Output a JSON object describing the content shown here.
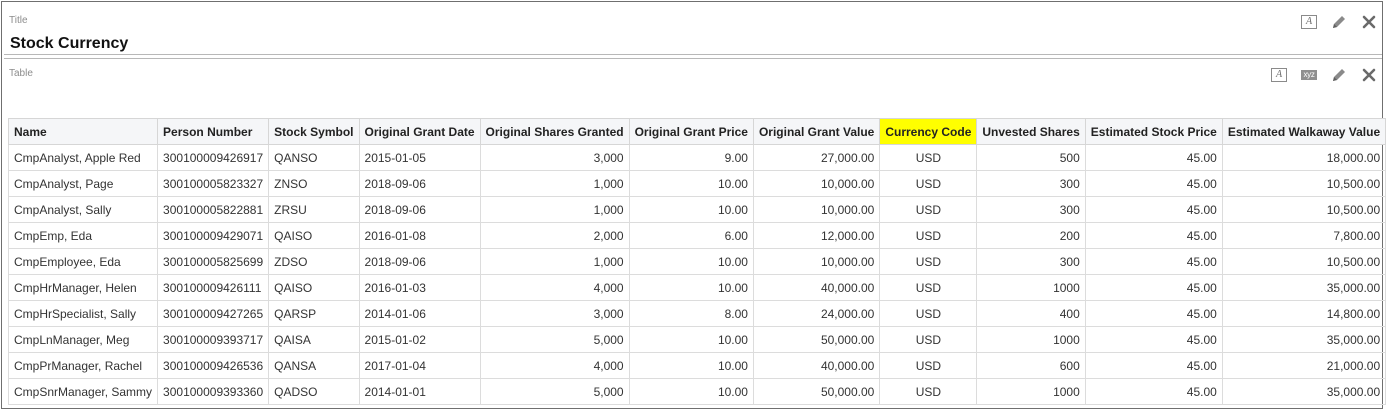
{
  "title_section": {
    "caption": "Title",
    "title": "Stock Currency"
  },
  "table_section": {
    "caption": "Table"
  },
  "table": {
    "headers": [
      "Name",
      "Person Number",
      "Stock Symbol",
      "Original Grant Date",
      "Original Shares Granted",
      "Original Grant Price",
      "Original Grant Value",
      "Currency Code",
      "Unvested Shares",
      "Estimated Stock Price",
      "Estimated Walkaway Value"
    ],
    "highlight_color": "#ffff00",
    "rows": [
      [
        "CmpAnalyst, Apple Red",
        "300100009426917",
        "QANSO",
        "2015-01-05",
        "3,000",
        "9.00",
        "27,000.00",
        "USD",
        "500",
        "45.00",
        "18,000.00"
      ],
      [
        "CmpAnalyst, Page",
        "300100005823327",
        "ZNSO",
        "2018-09-06",
        "1,000",
        "10.00",
        "10,000.00",
        "USD",
        "300",
        "45.00",
        "10,500.00"
      ],
      [
        "CmpAnalyst, Sally",
        "300100005822881",
        "ZRSU",
        "2018-09-06",
        "1,000",
        "10.00",
        "10,000.00",
        "USD",
        "300",
        "45.00",
        "10,500.00"
      ],
      [
        "CmpEmp, Eda",
        "300100009429071",
        "QAISO",
        "2016-01-08",
        "2,000",
        "6.00",
        "12,000.00",
        "USD",
        "200",
        "45.00",
        "7,800.00"
      ],
      [
        "CmpEmployee, Eda",
        "300100005825699",
        "ZDSO",
        "2018-09-06",
        "1,000",
        "10.00",
        "10,000.00",
        "USD",
        "300",
        "45.00",
        "10,500.00"
      ],
      [
        "CmpHrManager, Helen",
        "300100009426111",
        "QAISO",
        "2016-01-03",
        "4,000",
        "10.00",
        "40,000.00",
        "USD",
        "1000",
        "45.00",
        "35,000.00"
      ],
      [
        "CmpHrSpecialist, Sally",
        "300100009427265",
        "QARSP",
        "2014-01-06",
        "3,000",
        "8.00",
        "24,000.00",
        "USD",
        "400",
        "45.00",
        "14,800.00"
      ],
      [
        "CmpLnManager, Meg",
        "300100009393717",
        "QAISA",
        "2015-01-02",
        "5,000",
        "10.00",
        "50,000.00",
        "USD",
        "1000",
        "45.00",
        "35,000.00"
      ],
      [
        "CmpPrManager, Rachel",
        "300100009426536",
        "QANSA",
        "2017-01-04",
        "4,000",
        "10.00",
        "40,000.00",
        "USD",
        "600",
        "45.00",
        "21,000.00"
      ],
      [
        "CmpSnrManager, Sammy",
        "300100009393360",
        "QADSO",
        "2014-01-01",
        "5,000",
        "10.00",
        "50,000.00",
        "USD",
        "1000",
        "45.00",
        "35,000.00"
      ]
    ]
  },
  "icons": {
    "title_tools": [
      "text-format-icon",
      "edit-pencil-icon",
      "close-icon"
    ],
    "table_tools": [
      "text-format-icon",
      "xyz-format-icon",
      "edit-pencil-icon",
      "close-icon"
    ],
    "xyz_label": "xyz"
  }
}
